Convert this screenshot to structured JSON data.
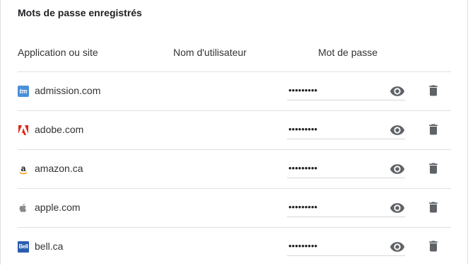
{
  "section": {
    "title": "Mots de passe enregistrés"
  },
  "columns": {
    "site": "Application ou site",
    "username": "Nom d'utilisateur",
    "password": "Mot de passe"
  },
  "rows": [
    {
      "site": "admission.com",
      "username": "",
      "password": "•••••••••",
      "icon": "admission-tm-icon"
    },
    {
      "site": "adobe.com",
      "username": "",
      "password": "•••••••••",
      "icon": "adobe-logo-icon"
    },
    {
      "site": "amazon.ca",
      "username": "",
      "password": "•••••••••",
      "icon": "amazon-logo-icon"
    },
    {
      "site": "apple.com",
      "username": "",
      "password": "•••••••••",
      "icon": "apple-logo-icon"
    },
    {
      "site": "bell.ca",
      "username": "",
      "password": "•••••••••",
      "icon": "bell-logo-icon"
    }
  ],
  "icon_text": {
    "admission": "tm",
    "bell": "Bell"
  },
  "colors": {
    "icon_gray": "#5f6368",
    "divider": "#e0e0e0",
    "adobe_red": "#e1251b"
  }
}
